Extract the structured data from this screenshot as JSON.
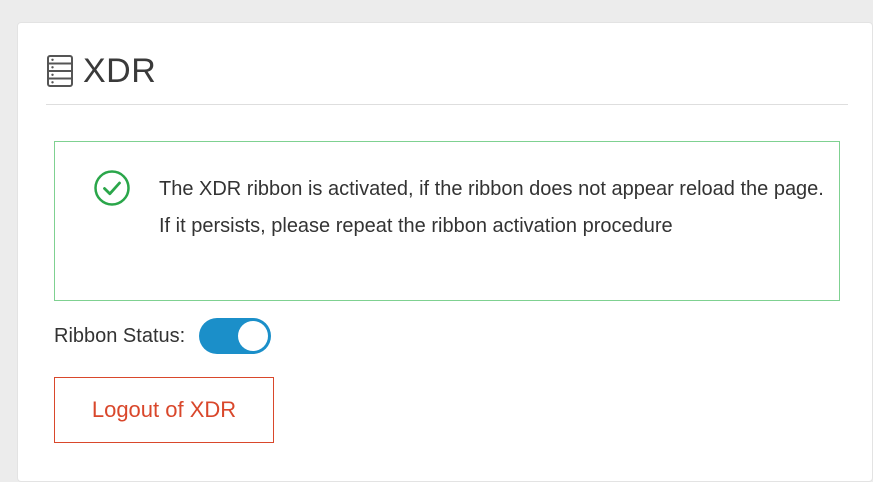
{
  "header": {
    "title": "XDR",
    "icon": "server-icon"
  },
  "alert": {
    "icon": "check-circle-icon",
    "message": "The XDR ribbon is activated, if the ribbon does not appear reload the page. If it persists, please repeat the ribbon activation procedure",
    "border_color": "#7fd191",
    "icon_color": "#2aa64a"
  },
  "ribbon_status": {
    "label": "Ribbon Status:",
    "enabled": true,
    "toggle_color": "#1b8fc9"
  },
  "logout_button": {
    "label": "Logout of XDR",
    "color": "#d9472b"
  }
}
